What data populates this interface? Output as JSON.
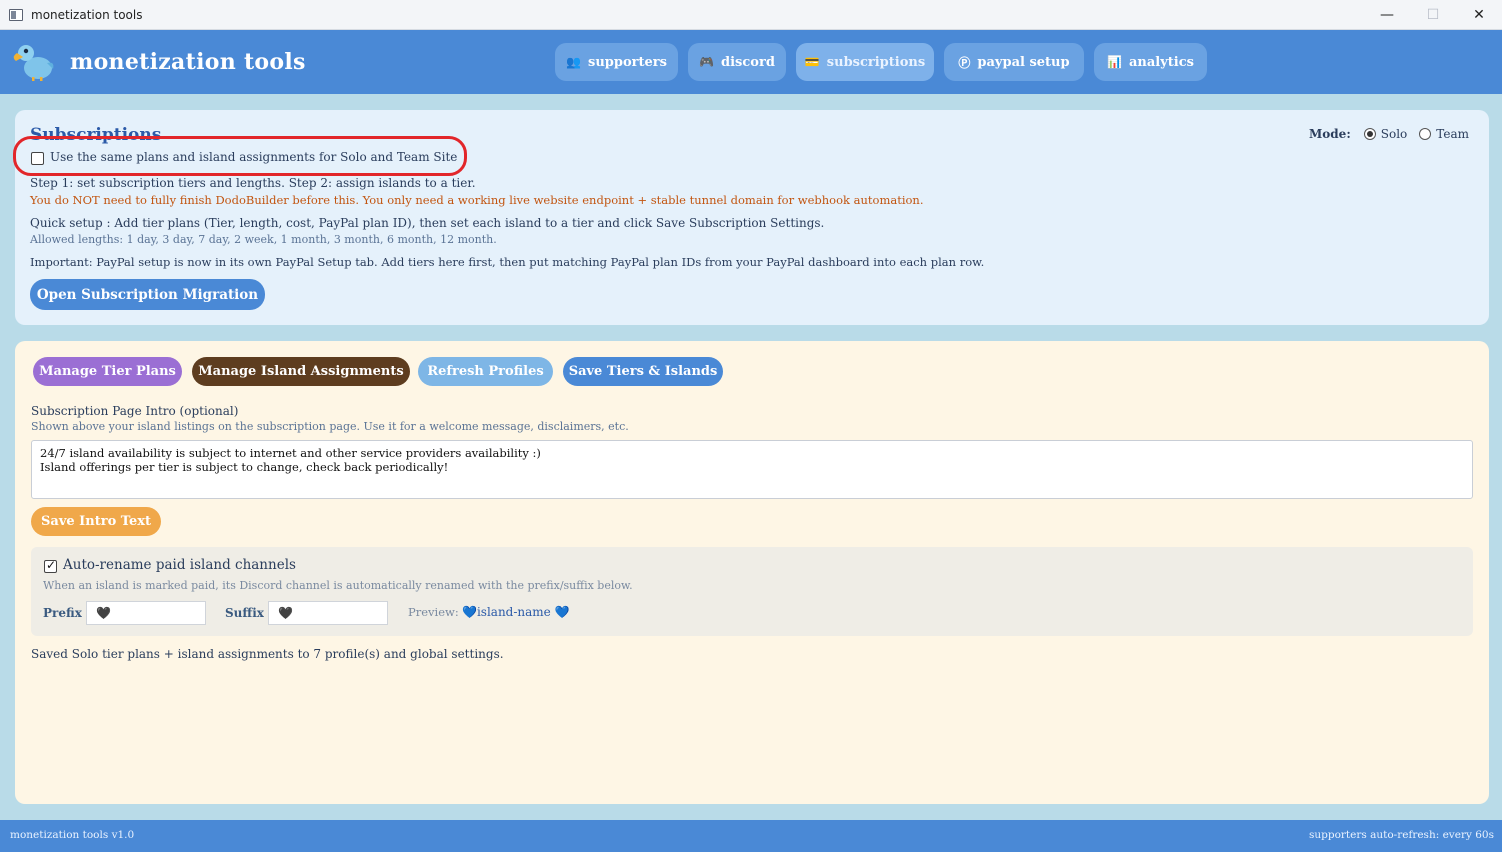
{
  "window": {
    "title": "monetization tools",
    "minimize_glyph": "—",
    "maximize_glyph": "☐",
    "close_glyph": "✕"
  },
  "header": {
    "brand": "monetization tools",
    "logo_icon": "dodo-bird-icon",
    "tabs": [
      {
        "label": "supporters",
        "icon": "people-icon",
        "glyph": "👥"
      },
      {
        "label": "discord",
        "icon": "gamepad-icon",
        "glyph": "🎮"
      },
      {
        "label": "subscriptions",
        "icon": "card-icon",
        "glyph": "💳"
      },
      {
        "label": "paypal setup",
        "icon": "paypal-icon",
        "glyph": "Ⓟ"
      },
      {
        "label": "analytics",
        "icon": "chart-icon",
        "glyph": "📊"
      }
    ],
    "active_tab": "subscriptions"
  },
  "subscriptions": {
    "title": "Subscriptions",
    "mode_label": "Mode:",
    "mode_options": [
      "Solo",
      "Team"
    ],
    "mode_selected": "Solo",
    "same_plans_label": "Use the same plans and island assignments for Solo and Team Site",
    "same_plans_checked": false,
    "step_text": "Step 1: set subscription tiers and lengths. Step 2: assign islands to a tier.",
    "warning_text": "You do NOT need to fully finish DodoBuilder before this. You only need a working live website endpoint + stable tunnel domain for webhook automation.",
    "quick_text": "Quick setup : Add tier plans (Tier, length, cost, PayPal plan ID), then set each island to a tier and click Save Subscription Settings.",
    "allowed_text": "Allowed lengths: 1 day, 3 day, 7 day, 2 week, 1 month, 3 month, 6 month, 12 month.",
    "important_text": "Important:  PayPal setup is now in its own PayPal Setup tab. Add tiers here first, then put matching PayPal plan IDs from your PayPal dashboard into each plan row.",
    "migration_button": "Open Subscription Migration"
  },
  "actions": {
    "manage_tier": "Manage Tier Plans",
    "manage_island": "Manage Island Assignments",
    "refresh_profiles": "Refresh Profiles",
    "save_tiers": "Save Tiers & Islands"
  },
  "intro": {
    "label": "Subscription Page Intro (optional)",
    "help": "Shown above your island listings on the subscription page. Use it for a welcome message, disclaimers, etc.",
    "value": "24/7 island availability is subject to internet and other service providers availability :)\nIsland offerings per tier is subject to change, check back periodically!",
    "save_button": "Save Intro Text"
  },
  "rename": {
    "label": "Auto-rename paid island channels",
    "checked": true,
    "help": "When an island is marked paid, its Discord channel is automatically renamed with the prefix/suffix below.",
    "prefix_label": "Prefix",
    "prefix_value": "🖤",
    "suffix_label": "Suffix",
    "suffix_value": "🖤",
    "preview_label": "Preview:",
    "preview_heart": "💙",
    "preview_value": "island-name"
  },
  "status": {
    "saved": "Saved Solo tier plans + island assignments to 7 profile(s) and global settings."
  },
  "footer": {
    "version": "monetization tools v1.0",
    "refresh": "supporters auto-refresh: every 60s"
  },
  "colors": {
    "accent": "#4a89d6",
    "highlight_box": "#e2262a",
    "manage_tier": "#9b6fd4",
    "manage_island": "#5e3d1f",
    "save_intro": "#f0a84a"
  }
}
